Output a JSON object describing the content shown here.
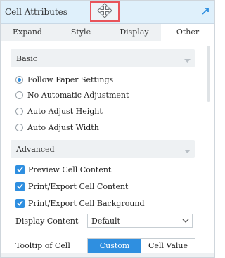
{
  "panel": {
    "title": "Cell Attributes",
    "move_icon": "move-arrows-icon",
    "expand_icon": "expand-arrow-icon"
  },
  "tabs": [
    {
      "label": "Expand",
      "active": false
    },
    {
      "label": "Style",
      "active": false
    },
    {
      "label": "Display",
      "active": false
    },
    {
      "label": "Other",
      "active": true
    }
  ],
  "basic": {
    "header": "Basic",
    "options": [
      {
        "label": "Follow Paper Settings",
        "selected": true
      },
      {
        "label": "No Automatic Adjustment",
        "selected": false
      },
      {
        "label": "Auto Adjust Height",
        "selected": false
      },
      {
        "label": "Auto Adjust Width",
        "selected": false
      }
    ]
  },
  "advanced": {
    "header": "Advanced",
    "checks": [
      {
        "label": "Preview Cell Content",
        "checked": true
      },
      {
        "label": "Print/Export Cell Content",
        "checked": true
      },
      {
        "label": "Print/Export Cell Background",
        "checked": true
      }
    ],
    "display_content": {
      "label": "Display Content",
      "value": "Default"
    },
    "tooltip": {
      "label": "Tooltip of Cell",
      "options": [
        "Custom",
        "Cell Value"
      ],
      "selected": "Custom"
    }
  },
  "colors": {
    "accent": "#2f8fe0",
    "titlebar": "#dff0fb",
    "highlight_border": "#e8545a"
  }
}
